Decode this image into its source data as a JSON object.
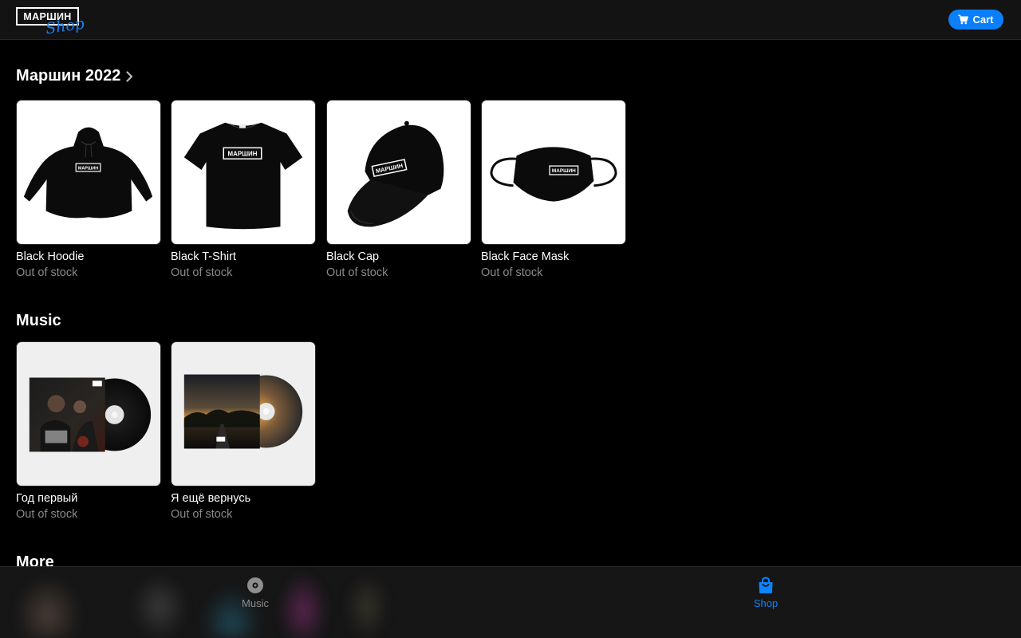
{
  "header": {
    "logo_text": "МАРШИН",
    "logo_script": "Shop",
    "cart_label": "Cart",
    "cart_icon": "cart-icon",
    "accent_color": "#0a7ff9"
  },
  "sections": [
    {
      "title": "Маршин 2022",
      "has_chevron": true,
      "items": [
        {
          "name": "Black Hoodie",
          "status": "Out of stock",
          "image_icon": "hoodie",
          "print_text": "МАРШИН"
        },
        {
          "name": "Black T-Shirt",
          "status": "Out of stock",
          "image_icon": "t-shirt",
          "print_text": "МАРШИН"
        },
        {
          "name": "Black Cap",
          "status": "Out of stock",
          "image_icon": "cap",
          "print_text": "МАРШИН"
        },
        {
          "name": "Black Face Mask",
          "status": "Out of stock",
          "image_icon": "face-mask",
          "print_text": "МАРШИН"
        }
      ]
    },
    {
      "title": "Music",
      "has_chevron": false,
      "items": [
        {
          "name": "Год первый",
          "status": "Out of stock",
          "image_icon": "cd-album"
        },
        {
          "name": "Я ещё вернусь",
          "status": "Out of stock",
          "image_icon": "cd-album"
        }
      ]
    },
    {
      "title": "More",
      "has_chevron": false,
      "items": []
    }
  ],
  "tabbar": {
    "tabs": [
      {
        "label": "Music",
        "icon": "disc-icon",
        "active": false
      },
      {
        "label": "Shop",
        "icon": "shopping-bag-icon",
        "active": true
      }
    ],
    "active_color": "#0a84ff",
    "inactive_color": "#8e8e8e"
  }
}
